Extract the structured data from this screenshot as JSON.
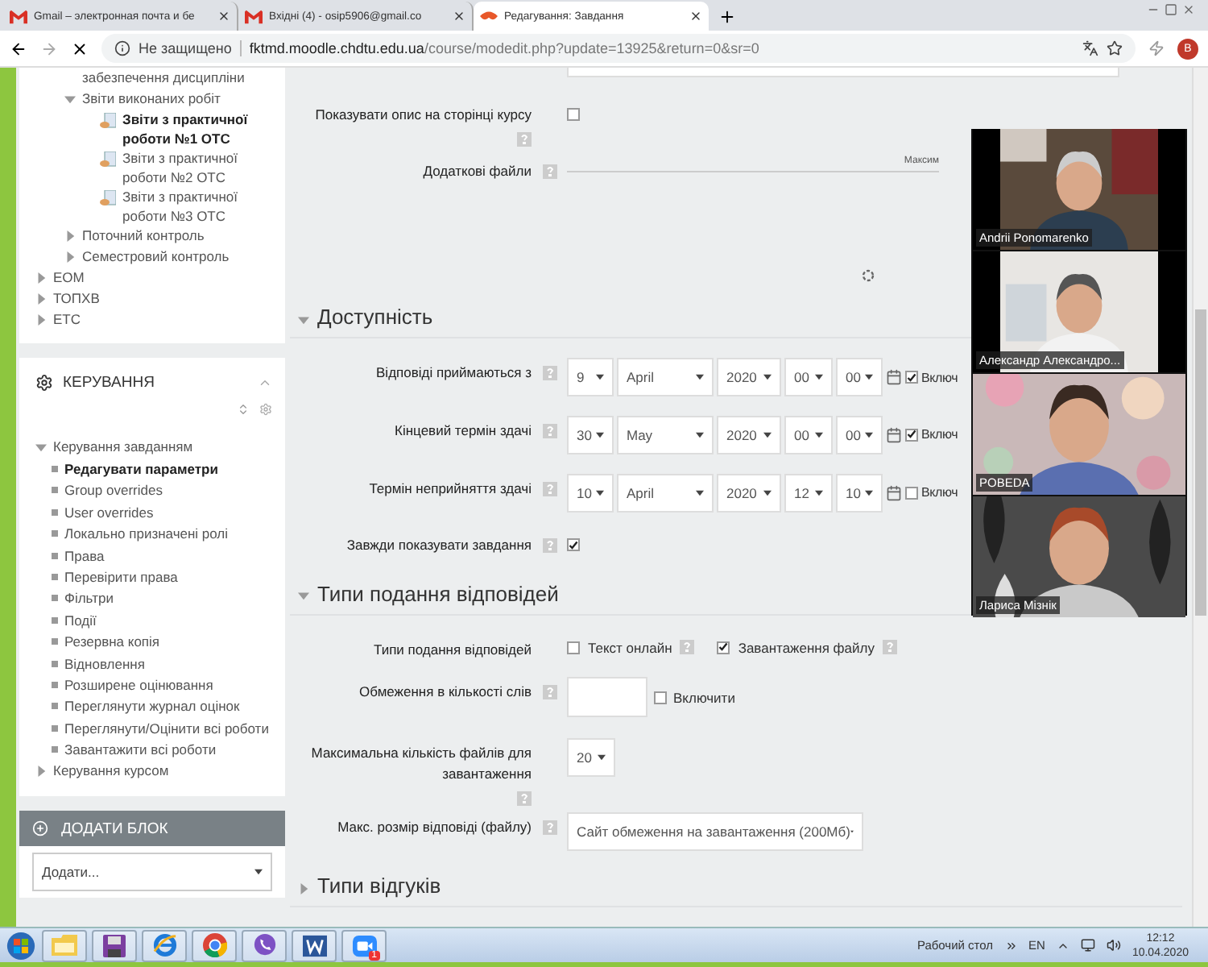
{
  "browser": {
    "tabs": [
      {
        "title": "Gmail – электронная почта и бе",
        "kind": "gmail",
        "selected": false
      },
      {
        "title": "Вхідні (4) - osip5906@gmail.co",
        "kind": "gmail",
        "selected": false
      },
      {
        "title": "Редагування: Завдання",
        "kind": "moodle",
        "selected": true
      }
    ],
    "security": "Не защищено",
    "url_host": "fktmd.moodle.chdtu.edu.ua",
    "url_path": "/course/modedit.php?update=13925&return=0&sr=0",
    "avatar": "B"
  },
  "navigation": {
    "items": [
      {
        "kind": "group",
        "children": [
          {
            "label": "забезпечення дисципліни",
            "kind": "text"
          },
          {
            "label": "Звіти виконаних робіт",
            "kind": "folder",
            "expanded": true,
            "children": [
              {
                "label": "Звіти з практичної роботи №1 ОТС",
                "kind": "file",
                "selected": true
              },
              {
                "label": "Звіти з практичної роботи №2 ОТС",
                "kind": "file",
                "selected": false
              },
              {
                "label": "Звіти з практичної роботи №3 ОТС",
                "kind": "file",
                "selected": false
              }
            ]
          },
          {
            "label": "Поточний контроль",
            "kind": "folder",
            "expanded": false
          },
          {
            "label": "Семестровий контроль",
            "kind": "folder",
            "expanded": false
          }
        ]
      },
      {
        "label": "ЕОМ",
        "kind": "folder",
        "expanded": false
      },
      {
        "label": "ТОПХВ",
        "kind": "folder",
        "expanded": false
      },
      {
        "label": "ЕТС",
        "kind": "folder",
        "expanded": false
      }
    ]
  },
  "administration": {
    "title": "КЕРУВАННЯ",
    "tree": [
      {
        "label": "Керування завданням",
        "expanded": true,
        "children": [
          {
            "label": "Редагувати параметри",
            "selected": true
          },
          {
            "label": "Group overrides",
            "selected": false
          },
          {
            "label": "User overrides",
            "selected": false
          },
          {
            "label": "Локально призначені ролі",
            "selected": false
          },
          {
            "label": "Права",
            "selected": false
          },
          {
            "label": "Перевірити права",
            "selected": false
          },
          {
            "label": "Фільтри",
            "selected": false
          },
          {
            "label": "Події",
            "selected": false
          },
          {
            "label": "Резервна копія",
            "selected": false
          },
          {
            "label": "Відновлення",
            "selected": false
          },
          {
            "label": "Розширене оцінювання",
            "selected": false
          },
          {
            "label": "Переглянути журнал оцінок",
            "selected": false
          },
          {
            "label": "Переглянути/Оцінити всі роботи",
            "selected": false
          },
          {
            "label": "Завантажити всі роботи",
            "selected": false
          }
        ]
      },
      {
        "label": "Керування курсом",
        "expanded": false
      }
    ]
  },
  "add_block": {
    "title": "ДОДАТИ БЛОК",
    "select": "Додати..."
  },
  "form": {
    "top_rows": [
      {
        "kind": "checkbox",
        "label": "Показувати опис на сторінці курсу",
        "checked": false
      },
      {
        "kind": "files",
        "label": "Додаткові файли",
        "note": "Максим"
      }
    ],
    "sections": [
      {
        "title": "Доступність",
        "expanded": true,
        "rows": [
          {
            "kind": "date",
            "label": "Відповіді приймаються з",
            "fields": [
              "9",
              "April",
              "2020",
              "00",
              "00"
            ],
            "enabled": true,
            "enable_label": "Включ"
          },
          {
            "kind": "date",
            "label": "Кінцевий термін здачі",
            "fields": [
              "30",
              "May",
              "2020",
              "00",
              "00"
            ],
            "enabled": true,
            "enable_label": "Включ"
          },
          {
            "kind": "date",
            "label": "Термін неприйняття здачі",
            "fields": [
              "10",
              "April",
              "2020",
              "12",
              "10"
            ],
            "enabled": false,
            "enable_label": "Включ"
          },
          {
            "kind": "checkbox",
            "label": "Завжди показувати завдання",
            "checked": true
          }
        ]
      },
      {
        "title": "Типи подання відповідей",
        "expanded": true,
        "rows": [
          {
            "kind": "options",
            "label": "Типи подання відповідей",
            "options": [
              {
                "label": "Текст онлайн",
                "checked": false
              },
              {
                "label": "Завантаження файлу",
                "checked": true
              }
            ]
          },
          {
            "kind": "wordlimit",
            "label": "Обмеження в кількості слів",
            "enable_label": "Включити",
            "enabled": false
          },
          {
            "kind": "count_select",
            "label": "Максимальна кількість файлів для завантаження",
            "value": "20"
          },
          {
            "kind": "size_select",
            "label": "Макс. розмір відповіді (файлу)",
            "value": "Сайт обмеження на завантаження (200Мб)"
          }
        ]
      },
      {
        "title": "Типи відгуків",
        "expanded": false
      }
    ]
  },
  "meeting": {
    "participants": [
      {
        "name": "Andrii Ponomarenko"
      },
      {
        "name": "Александр Александро..."
      },
      {
        "name": "POBEDA"
      },
      {
        "name": "Лариса Мізнік"
      }
    ]
  },
  "taskbar": {
    "apps": [
      {
        "kind": "folder"
      },
      {
        "kind": "floppy"
      },
      {
        "kind": "ie"
      },
      {
        "kind": "chrome"
      },
      {
        "kind": "viber"
      },
      {
        "kind": "word"
      },
      {
        "kind": "zoom",
        "badge": "1"
      }
    ],
    "desktop_label": "Рабочий стол",
    "language": "EN",
    "time": "12:12",
    "date": "10.04.2020"
  }
}
